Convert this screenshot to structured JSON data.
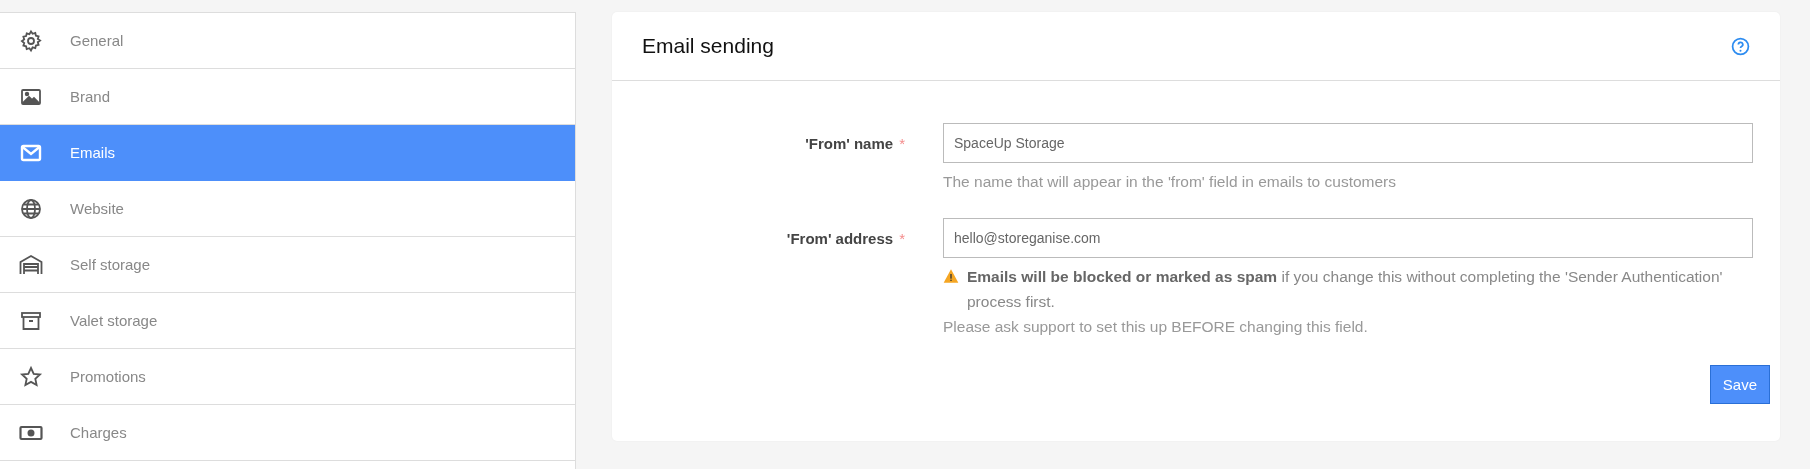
{
  "sidebar": {
    "items": [
      {
        "label": "General",
        "selected": false
      },
      {
        "label": "Brand",
        "selected": false
      },
      {
        "label": "Emails",
        "selected": true
      },
      {
        "label": "Website",
        "selected": false
      },
      {
        "label": "Self storage",
        "selected": false
      },
      {
        "label": "Valet storage",
        "selected": false
      },
      {
        "label": "Promotions",
        "selected": false
      },
      {
        "label": "Charges",
        "selected": false
      }
    ]
  },
  "panel": {
    "title": "Email sending",
    "fields": [
      {
        "label": "'From' name",
        "required": true,
        "value": "SpaceUp Storage",
        "help": [
          "The name that will appear in the 'from' field in emails to customers"
        ],
        "warning": false
      },
      {
        "label": "'From' address",
        "required": true,
        "value": "hello@storeganise.com",
        "help": [
          "**Emails will be blocked or marked as spam** if you change this without completing the 'Sender Authentication' process first.",
          "Please ask support to set this up BEFORE changing this field."
        ],
        "warning": true
      }
    ],
    "required_mark": "*",
    "save": "Save"
  }
}
